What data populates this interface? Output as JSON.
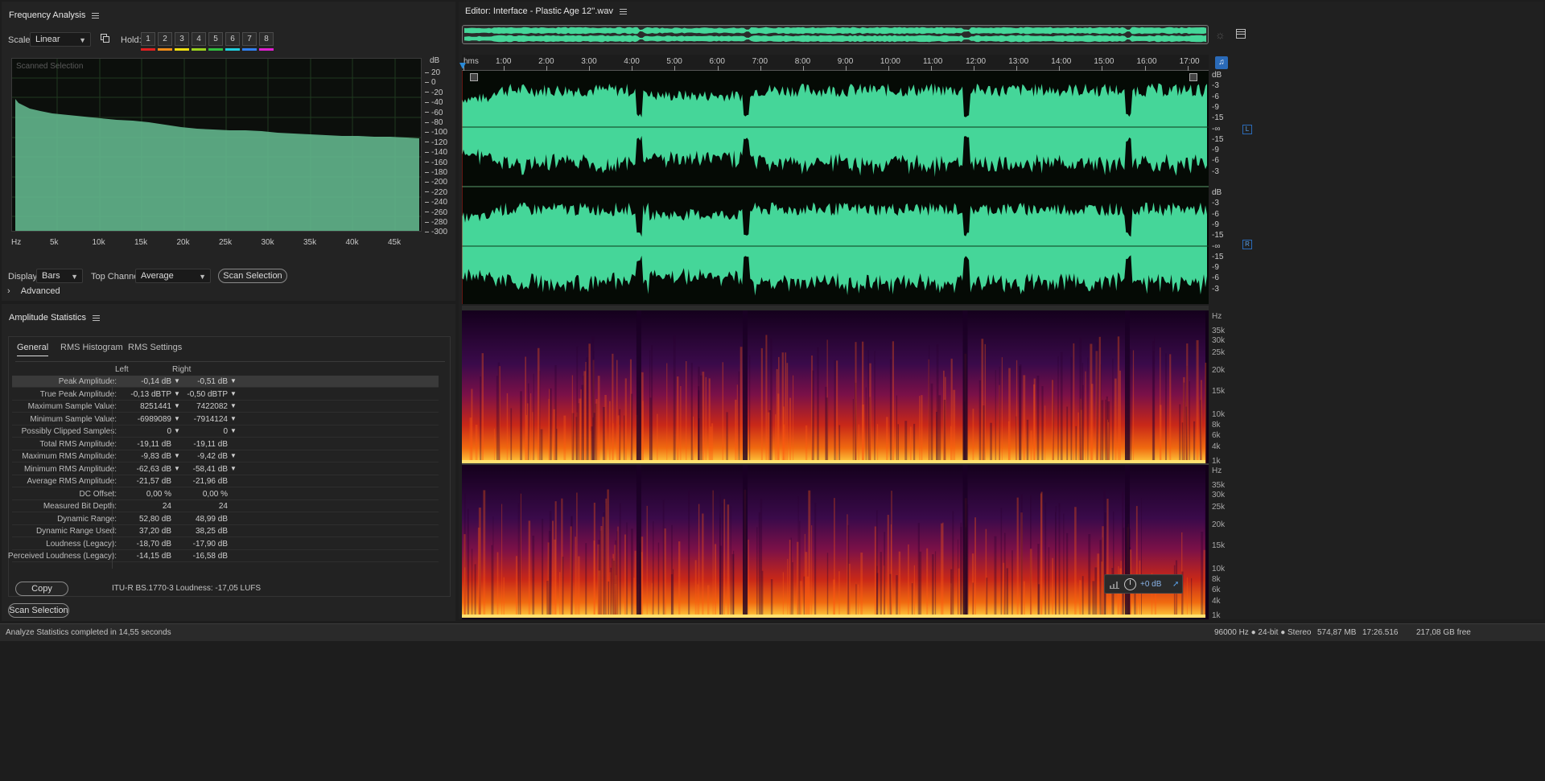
{
  "freq_panel": {
    "title": "Frequency Analysis",
    "scale_label": "Scale:",
    "scale_value": "Linear",
    "hold_label": "Hold:",
    "hold_buttons": [
      "1",
      "2",
      "3",
      "4",
      "5",
      "6",
      "7",
      "8"
    ],
    "hold_colors": [
      "#e02020",
      "#f08c18",
      "#f0e010",
      "#9bd21e",
      "#30c040",
      "#20d0e0",
      "#3080f0",
      "#e020d0"
    ],
    "graph_label": "Scanned Selection",
    "db_unit": "dB",
    "db_ticks": [
      "20",
      "0",
      "-20",
      "-40",
      "-60",
      "-80",
      "-100",
      "-120",
      "-140",
      "-160",
      "-180",
      "-200",
      "-220",
      "-240",
      "-260",
      "-280",
      "-300"
    ],
    "hz_ticks": [
      "Hz",
      "5k",
      "10k",
      "15k",
      "20k",
      "25k",
      "30k",
      "35k",
      "40k",
      "45k"
    ],
    "display_label": "Display:",
    "display_value": "Bars",
    "top_channel_label": "Top Channel:",
    "top_channel_value": "Average",
    "scan_button": "Scan Selection",
    "advanced_label": "Advanced"
  },
  "amp_panel": {
    "title": "Amplitude Statistics",
    "tabs": [
      "General",
      "RMS Histogram",
      "RMS Settings"
    ],
    "col_left": "Left",
    "col_right": "Right",
    "rows": [
      {
        "label": "Peak Amplitude:",
        "left": "-0,14 dB",
        "right": "-0,51 dB",
        "marker": true
      },
      {
        "label": "True Peak Amplitude:",
        "left": "-0,13 dBTP",
        "right": "-0,50 dBTP",
        "marker": true
      },
      {
        "label": "Maximum Sample Value:",
        "left": "8251441",
        "right": "7422082",
        "marker": true
      },
      {
        "label": "Minimum Sample Value:",
        "left": "-6989089",
        "right": "-7914124",
        "marker": true
      },
      {
        "label": "Possibly Clipped Samples:",
        "left": "0",
        "right": "0",
        "marker": true
      },
      {
        "label": "Total RMS Amplitude:",
        "left": "-19,11 dB",
        "right": "-19,11 dB",
        "marker": false
      },
      {
        "label": "Maximum RMS Amplitude:",
        "left": "-9,83 dB",
        "right": "-9,42 dB",
        "marker": true
      },
      {
        "label": "Minimum RMS Amplitude:",
        "left": "-62,63 dB",
        "right": "-58,41 dB",
        "marker": true
      },
      {
        "label": "Average RMS Amplitude:",
        "left": "-21,57 dB",
        "right": "-21,96 dB",
        "marker": false
      },
      {
        "label": "DC Offset:",
        "left": "0,00 %",
        "right": "0,00 %",
        "marker": false
      },
      {
        "label": "Measured Bit Depth:",
        "left": "24",
        "right": "24",
        "marker": false
      },
      {
        "label": "Dynamic Range:",
        "left": "52,80 dB",
        "right": "48,99 dB",
        "marker": false
      },
      {
        "label": "Dynamic Range Used:",
        "left": "37,20 dB",
        "right": "38,25 dB",
        "marker": false
      },
      {
        "label": "Loudness (Legacy):",
        "left": "-18,70 dB",
        "right": "-17,90 dB",
        "marker": false
      },
      {
        "label": "Perceived Loudness (Legacy):",
        "left": "-14,15 dB",
        "right": "-16,58 dB",
        "marker": false
      }
    ],
    "copy_button": "Copy",
    "loudness_text": "ITU-R BS.1770-3 Loudness: -17,05 LUFS",
    "scan_button": "Scan Selection"
  },
  "editor": {
    "title": "Editor: Interface - Plastic Age 12''.wav",
    "time_ticks": [
      "hms",
      "1:00",
      "2:00",
      "3:00",
      "4:00",
      "5:00",
      "6:00",
      "7:00",
      "8:00",
      "9:00",
      "10:00",
      "11:00",
      "12:00",
      "13:00",
      "14:00",
      "15:00",
      "16:00",
      "17:00"
    ],
    "wave_db_ticks": [
      "dB",
      "-3",
      "-6",
      "-9",
      "-15",
      "-∞",
      "-15",
      "-9",
      "-6",
      "-3"
    ],
    "channel_left": "L",
    "channel_right": "R",
    "spec_hz_ticks": [
      "Hz",
      "35k",
      "30k",
      "25k",
      "20k",
      "15k",
      "10k",
      "8k",
      "6k",
      "4k",
      "1k"
    ],
    "volume_value": "+0 dB",
    "waveform_color": "#45d699"
  },
  "status_bar": {
    "message": "Analyze Statistics completed in 14,55 seconds",
    "format": "96000 Hz ● 24-bit ● Stereo",
    "size": "574,87 MB",
    "duration": "17:26.516",
    "free": "217,08 GB free"
  }
}
